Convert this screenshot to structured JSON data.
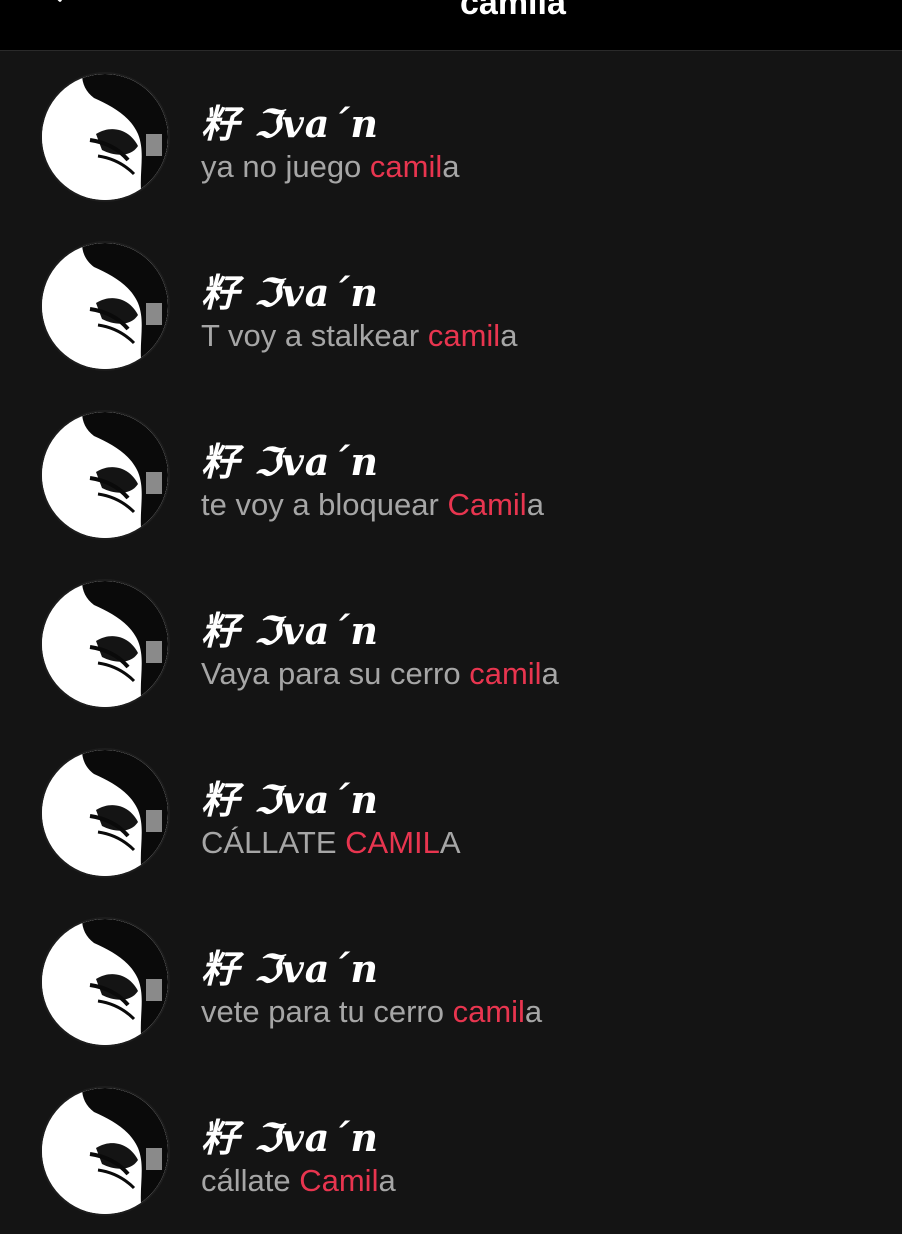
{
  "header": {
    "back_icon": "chevron-left-icon",
    "title": "camila"
  },
  "colors": {
    "background": "#141414",
    "header_background": "#000000",
    "name_text": "#ffffff",
    "message_text": "#a6a6a6",
    "highlight": "#e8354f"
  },
  "results": [
    {
      "name": "籽 ℑva΄n",
      "prefix": "ya no juego ",
      "match": "camil",
      "suffix": "a"
    },
    {
      "name": "籽 ℑva΄n",
      "prefix": "T voy a stalkear ",
      "match": "camil",
      "suffix": "a"
    },
    {
      "name": "籽 ℑva΄n",
      "prefix": "te voy a bloquear ",
      "match": "Camil",
      "suffix": "a"
    },
    {
      "name": "籽 ℑva΄n",
      "prefix": "Vaya para su cerro ",
      "match": "camil",
      "suffix": "a"
    },
    {
      "name": "籽 ℑva΄n",
      "prefix": "CÁLLATE ",
      "match": "CAMIL",
      "suffix": "A"
    },
    {
      "name": "籽 ℑva΄n",
      "prefix": "vete para tu cerro ",
      "match": "camil",
      "suffix": "a"
    },
    {
      "name": "籽 ℑva΄n",
      "prefix": "cállate ",
      "match": "Camil",
      "suffix": "a"
    }
  ]
}
